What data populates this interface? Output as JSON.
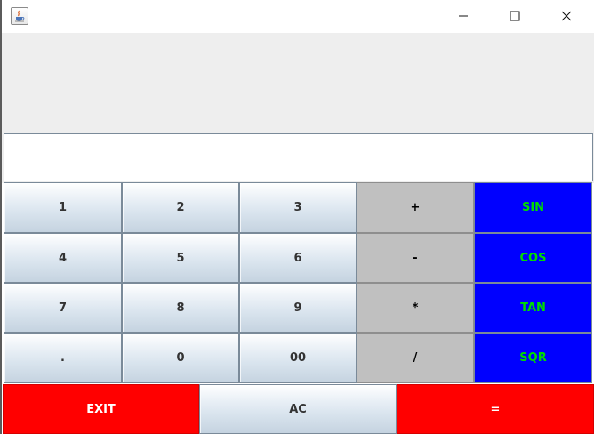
{
  "window": {
    "icon": "java-cup-icon",
    "controls": {
      "minimize": "minimize-icon",
      "maximize": "maximize-icon",
      "close": "close-icon"
    }
  },
  "display": {
    "value": ""
  },
  "keypad": {
    "rows": [
      {
        "keys": [
          {
            "label": "1"
          },
          {
            "label": "2"
          },
          {
            "label": "3"
          },
          {
            "label": "+"
          },
          {
            "label": "SIN"
          }
        ]
      },
      {
        "keys": [
          {
            "label": "4"
          },
          {
            "label": "5"
          },
          {
            "label": "6"
          },
          {
            "label": "-"
          },
          {
            "label": "COS"
          }
        ]
      },
      {
        "keys": [
          {
            "label": "7"
          },
          {
            "label": "8"
          },
          {
            "label": "9"
          },
          {
            "label": "*"
          },
          {
            "label": "TAN"
          }
        ]
      },
      {
        "keys": [
          {
            "label": "."
          },
          {
            "label": "0"
          },
          {
            "label": "00"
          },
          {
            "label": "/"
          },
          {
            "label": "SQR"
          }
        ]
      }
    ]
  },
  "bottom": {
    "exit_label": "EXIT",
    "clear_label": "AC",
    "equals_label": "="
  },
  "colors": {
    "operator_key": "#c0c0c0",
    "function_key": "#0000ff",
    "function_text": "#00dd00",
    "action_key": "#ff0000",
    "action_text": "#ffffff",
    "empty_panel": "#eeeeee"
  }
}
